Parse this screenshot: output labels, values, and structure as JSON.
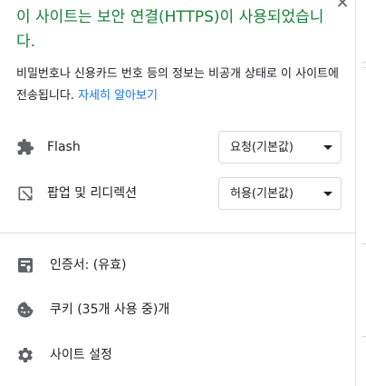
{
  "header": {
    "title": "이 사이트는 보안 연결(HTTPS)이 사용되었습니다.",
    "close_icon": "close-icon"
  },
  "description": {
    "text": "비밀번호나 신용카드 번호 등의 정보는 비공개 상태로 이 사이트에 전송됩니다. ",
    "learn_more": "자세히 알아보기"
  },
  "permissions": [
    {
      "icon": "puzzle-icon",
      "label": "Flash",
      "value": "요청(기본값)"
    },
    {
      "icon": "open-in-new-icon",
      "label": "팝업 및 리디렉션",
      "value": "허용(기본값)"
    }
  ],
  "links": [
    {
      "icon": "certificate-icon",
      "label": "인증서: (유효)"
    },
    {
      "icon": "cookie-icon",
      "label": "쿠키 (35개 사용 중)개"
    },
    {
      "icon": "gear-icon",
      "label": "사이트 설정"
    }
  ],
  "colors": {
    "secure_green": "#188038",
    "link_blue": "#1a73e8",
    "icon_gray": "#5f6368"
  }
}
